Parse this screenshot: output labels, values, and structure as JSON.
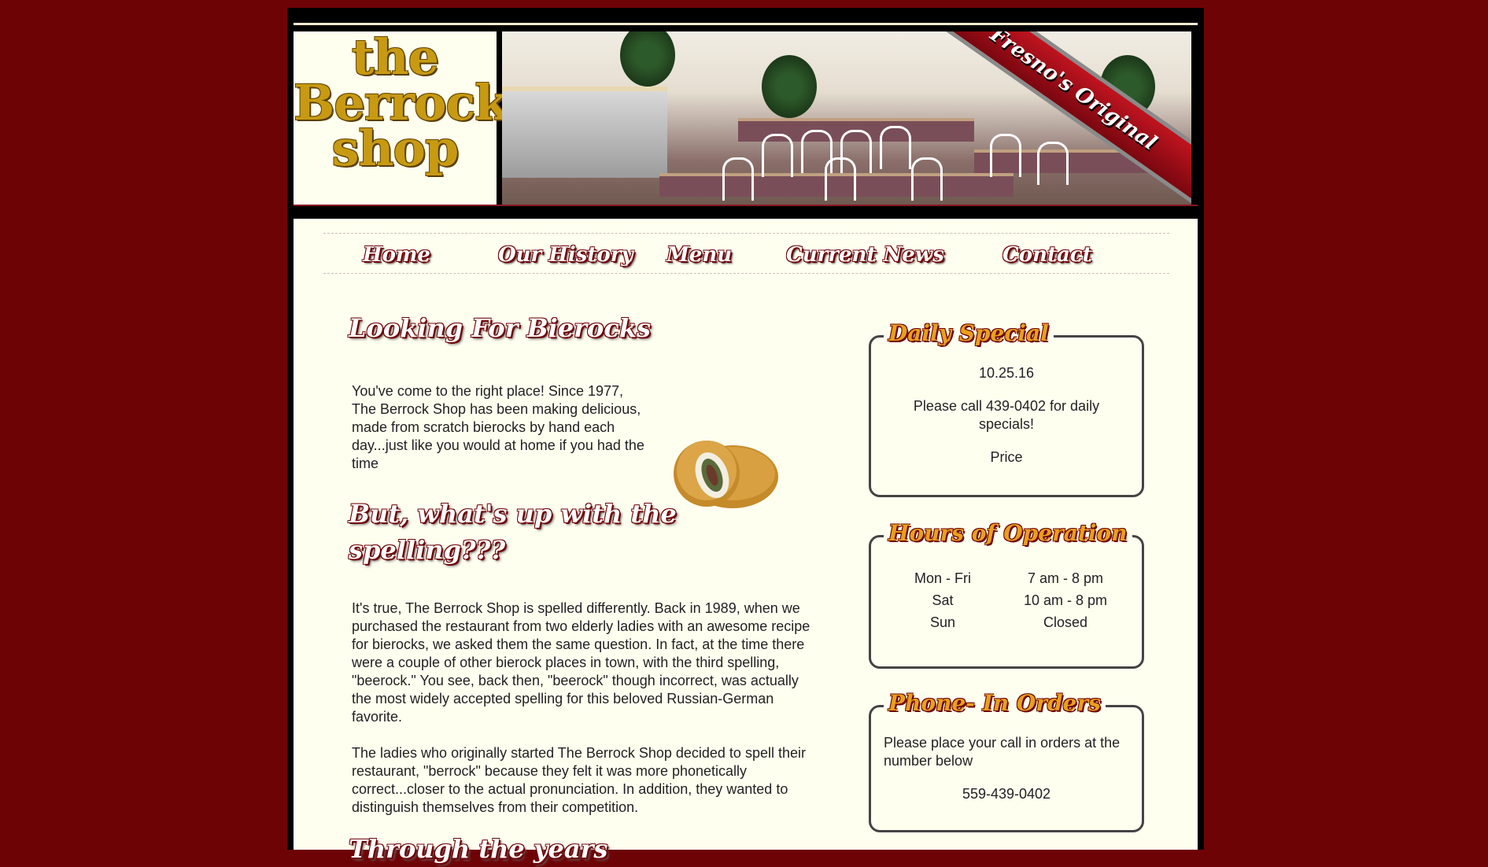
{
  "brand": {
    "logo_line1": "the",
    "logo_line2": "Berrock",
    "logo_line3": "shop",
    "ribbon": "Fresno's Original"
  },
  "nav": {
    "home": "Home",
    "history": "Our History",
    "menu": "Menu",
    "news": "Current News",
    "contact": "Contact"
  },
  "main": {
    "heading1": "Looking For Bierocks",
    "intro": "You've come to the right place! Since 1977, The Berrock Shop has been making delicious, made from scratch bierocks by hand each day...just like you would at home if you had the time",
    "heading2": "But, what's up with the spelling???",
    "para2": "It's true, The Berrock Shop is spelled differently. Back in 1989, when we purchased the restaurant from two elderly ladies with an awesome recipe for bierocks, we asked them the same question. In fact, at the time there were a couple of other bierock places in town, with the third spelling, \"beerock.\" You see, back then, \"beerock\" though incorrect, was actually the most widely accepted spelling for this beloved Russian-German favorite.",
    "para3": "The ladies who originally started The Berrock Shop decided to spell their restaurant, \"berrock\" because they felt it was more phonetically correct...closer to the actual pronunciation. In addition, they wanted to distinguish themselves from their competition.",
    "heading3": "Through the years"
  },
  "special": {
    "title": "Daily Special",
    "date": "10.25.16",
    "text": "Please call 439-0402 for daily specials!",
    "price": "Price"
  },
  "hours": {
    "title": "Hours of Operation",
    "rows": [
      {
        "day": "Mon - Fri",
        "time": "7 am - 8 pm"
      },
      {
        "day": "Sat",
        "time": "10 am - 8 pm"
      },
      {
        "day": "Sun",
        "time": "Closed"
      }
    ]
  },
  "phone": {
    "title": "Phone- In Orders",
    "text": "Please place your call in orders at the number below",
    "number": "559-439-0402"
  },
  "colors": {
    "background": "#6e0306",
    "content": "#fffff0",
    "logo_gold": "#c79a12",
    "accent_orange": "#e8a01a"
  }
}
